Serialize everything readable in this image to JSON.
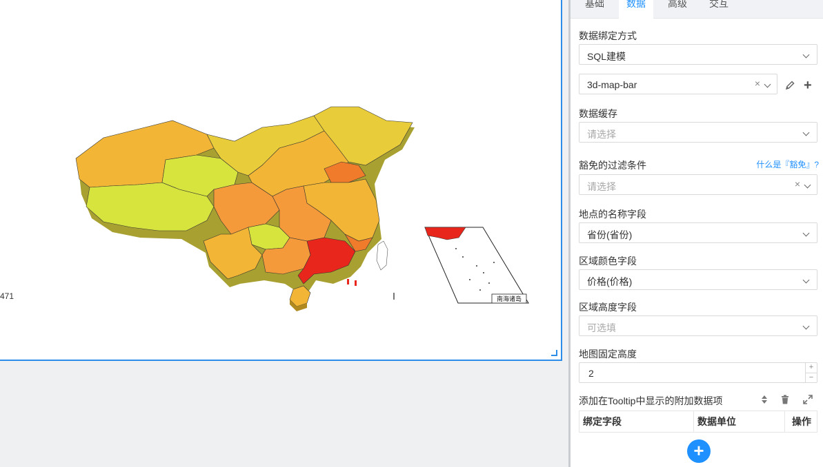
{
  "chart": {
    "edge_value": "471",
    "inset_label": "南海诸岛",
    "colors": {
      "high": "#e8261c",
      "mid_high": "#f07b2a",
      "mid": "#f59a3a",
      "mid_low": "#f2b535",
      "low": "#e8cc3a",
      "lowest": "#d8e43e",
      "side": "#a0a028"
    }
  },
  "tabs": [
    {
      "label": "基础",
      "active": false
    },
    {
      "label": "数据",
      "active": true
    },
    {
      "label": "高级",
      "active": false
    },
    {
      "label": "交互",
      "active": false
    }
  ],
  "form": {
    "binding_mode": {
      "label": "数据绑定方式",
      "value": "SQL建模"
    },
    "model": {
      "value": "3d-map-bar",
      "edit_icon": "pencil-icon",
      "add_icon": "plus-icon"
    },
    "cache": {
      "label": "数据缓存",
      "placeholder": "请选择"
    },
    "filter": {
      "label": "豁免的过滤条件",
      "help": "什么是『豁免』?",
      "placeholder": "请选择"
    },
    "location_field": {
      "label": "地点的名称字段",
      "value": "省份(省份)"
    },
    "color_field": {
      "label": "区域颜色字段",
      "value": "价格(价格)"
    },
    "height_field": {
      "label": "区域高度字段",
      "placeholder": "可选填"
    },
    "fixed_height": {
      "label": "地图固定高度",
      "value": "2"
    },
    "tooltip": {
      "label": "添加在Tooltip中显示的附加数据项",
      "columns": [
        "绑定字段",
        "数据单位",
        "操作"
      ],
      "add_button": "+"
    }
  },
  "accent_color": "#1e90ff"
}
